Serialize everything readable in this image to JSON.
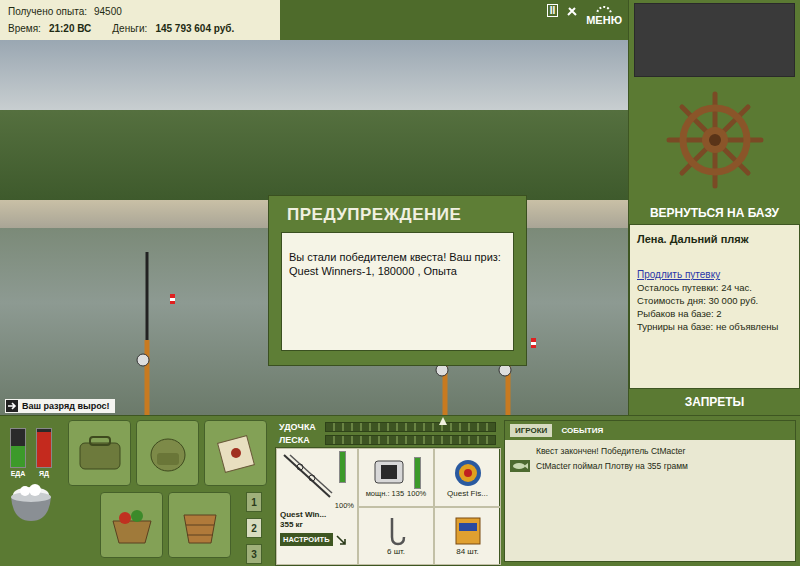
{
  "stats": [
    {
      "label": "Получено опыта:",
      "value": "94500"
    },
    {
      "label": "Время:",
      "value": "21:20 ВС"
    },
    {
      "label": "Деньги:",
      "value": "145 793 604 руб."
    }
  ],
  "top_buttons": {
    "pause": "II",
    "menu": "МЕНЮ"
  },
  "dialog": {
    "title": "ПРЕДУПРЕЖДЕНИЕ",
    "message": "Вы стали победителем квеста! Ваш приз: Quest Winners-1, 180000 , Опыта"
  },
  "notice": "Ваш разряд вырос!",
  "side": {
    "base_button": "ВЕРНУТЬСЯ НА БАЗУ",
    "location": "Лена. Дальний пляж",
    "extend_link": "Продлить путевку",
    "info": [
      "Осталось путевки: 24 час.",
      "Стоимость дня: 30 000 руб.",
      "Рыбаков на базе: 2",
      "Турниры на базе: не объявлены"
    ],
    "bans": "ЗАПРЕТЫ"
  },
  "gauges": [
    {
      "label": "ЕДА",
      "level": 0.55,
      "color": "#3c9a2a"
    },
    {
      "label": "ЯД",
      "level": 0.92,
      "color": "#c42a1e"
    }
  ],
  "slot_pages": [
    {
      "label": "1",
      "selected": false
    },
    {
      "label": "2",
      "selected": true
    },
    {
      "label": "3",
      "selected": false
    }
  ],
  "tension": [
    {
      "label": "УДОЧКА",
      "level": 0,
      "marker": 0.69
    },
    {
      "label": "ЛЕСКА",
      "level": 0
    }
  ],
  "tackle": {
    "rod": {
      "name": "Quest Win...",
      "reading": "355 кг",
      "durability": "100%",
      "level": 1,
      "button": "НАСТРОИТЬ"
    },
    "reel": {
      "text": "мощн.: 135",
      "durability": "100%",
      "level": 1
    },
    "lure": {
      "text": "Quest Fis..."
    },
    "hook": {
      "text": "6 шт."
    },
    "bait": {
      "text": "84 шт."
    }
  },
  "chat": {
    "tabs": [
      {
        "label": "ИГРОКИ",
        "selected": true
      },
      {
        "label": "СОБЫТИЯ",
        "selected": false
      }
    ],
    "messages": [
      {
        "text": "Квест закончен! Победитель CtMacter",
        "kind": "system"
      },
      {
        "text": "CtMacter поймал Плотву на 355 грамм",
        "kind": "catch"
      }
    ]
  }
}
